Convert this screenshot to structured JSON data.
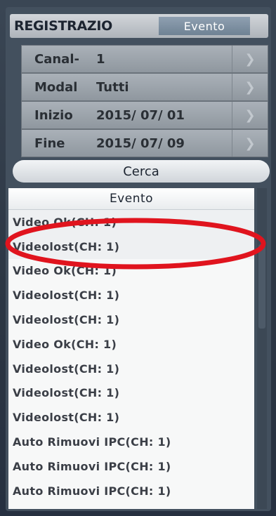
{
  "header": {
    "title": "REGISTRAZIO",
    "tab_label": "Evento"
  },
  "filters": [
    {
      "label": "Canal-",
      "value": "1"
    },
    {
      "label": "Modal",
      "value": "Tutti"
    },
    {
      "label": "Inizio",
      "value": "2015/ 07/ 01"
    },
    {
      "label": "Fine",
      "value": "2015/ 07/ 09"
    }
  ],
  "search": {
    "label": "Cerca"
  },
  "event_list": {
    "header": "Evento",
    "rows": [
      "Video  Ok(CH: 1)",
      "Videolost(CH: 1)",
      "Video  Ok(CH: 1)",
      "Videolost(CH: 1)",
      "Videolost(CH: 1)",
      "Video  Ok(CH: 1)",
      "Videolost(CH: 1)",
      "Videolost(CH: 1)",
      "Videolost(CH: 1)",
      "Auto  Rimuovi  IPC(CH: 1)",
      "Auto  Rimuovi  IPC(CH: 1)",
      "Auto  Rimuovi  IPC(CH: 1)"
    ]
  },
  "icons": {
    "arrow": "chevron-right-icon"
  },
  "colors": {
    "annotation": "#e0141e"
  }
}
